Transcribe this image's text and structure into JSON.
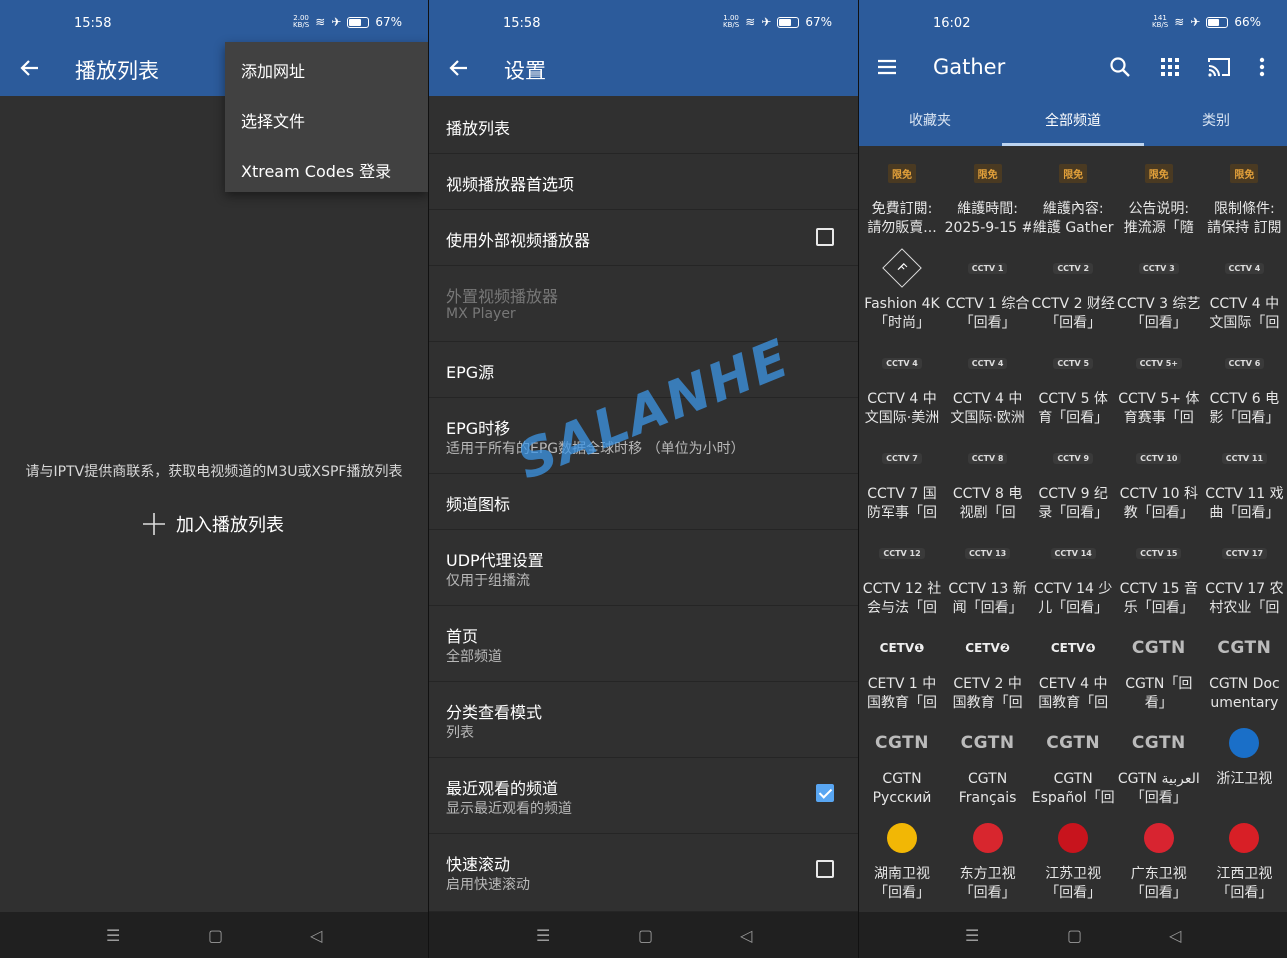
{
  "panels": [
    {
      "status": {
        "time": "15:58",
        "speed_value": "2.00",
        "speed_unit": "KB/S",
        "battery": "67%"
      },
      "title": "播放列表",
      "menu": [
        "添加网址",
        "选择文件",
        "Xtream Codes 登录"
      ],
      "message": "请与IPTV提供商联系，获取电视频道的M3U或XSPF播放列表",
      "add_label": "加入播放列表"
    },
    {
      "status": {
        "time": "15:58",
        "speed_value": "1.00",
        "speed_unit": "KB/S",
        "battery": "67%"
      },
      "title": "设置",
      "settings": [
        {
          "title": "播放列表",
          "subtitle": "",
          "checkbox": null
        },
        {
          "title": "视频播放器首选项",
          "subtitle": "",
          "checkbox": null
        },
        {
          "title": "使用外部视频播放器",
          "subtitle": "",
          "checkbox": false
        },
        {
          "title": "外置视频播放器",
          "subtitle": "MX Player",
          "checkbox": null,
          "disabled": true
        },
        {
          "title": "EPG源",
          "subtitle": "",
          "checkbox": null
        },
        {
          "title": "EPG时移",
          "subtitle": "适用于所有的EPG数据全球时移 （单位为小时）",
          "checkbox": null
        },
        {
          "title": "频道图标",
          "subtitle": "",
          "checkbox": null
        },
        {
          "title": "UDP代理设置",
          "subtitle": "仅用于组播流",
          "checkbox": null
        },
        {
          "title": "首页",
          "subtitle": "全部频道",
          "checkbox": null
        },
        {
          "title": "分类查看模式",
          "subtitle": "列表",
          "checkbox": null
        },
        {
          "title": "最近观看的频道",
          "subtitle": "显示最近观看的频道",
          "checkbox": true
        },
        {
          "title": "快速滚动",
          "subtitle": "启用快速滚动",
          "checkbox": false
        }
      ],
      "watermark": "SALANHE"
    },
    {
      "status": {
        "time": "16:02",
        "speed_value": "141",
        "speed_unit": "KB/S",
        "battery": "66%"
      },
      "title": "Gather",
      "tabs": [
        "收藏夹",
        "全部频道",
        "类别"
      ],
      "active_tab": 1,
      "channels": [
        {
          "line1": "免費訂閱:",
          "line2": "請勿販賣...",
          "logo": "限免",
          "kind": "sc"
        },
        {
          "line1": "維護時間:",
          "line2": "2025-9-15 #",
          "logo": "限免",
          "kind": "sc"
        },
        {
          "line1": "維護內容:",
          "line2": "維護 Gather",
          "logo": "限免",
          "kind": "sc"
        },
        {
          "line1": "公告说明:",
          "line2": "推流源「隨",
          "logo": "限免",
          "kind": "sc"
        },
        {
          "line1": "限制條件:",
          "line2": "請保持 訂閱",
          "logo": "限免",
          "kind": "sc"
        },
        {
          "line1": "Fashion 4K",
          "line2": "「时尚」",
          "logo": "F",
          "kind": "fashion"
        },
        {
          "line1": "CCTV 1 综合",
          "line2": "「回看」",
          "logo": "CCTV 1",
          "kind": "cctv"
        },
        {
          "line1": "CCTV 2 财经",
          "line2": "「回看」",
          "logo": "CCTV 2",
          "kind": "cctv"
        },
        {
          "line1": "CCTV 3 综艺",
          "line2": "「回看」",
          "logo": "CCTV 3",
          "kind": "cctv"
        },
        {
          "line1": "CCTV 4 中",
          "line2": "文国际「回",
          "logo": "CCTV 4",
          "kind": "cctv"
        },
        {
          "line1": "CCTV 4 中",
          "line2": "文国际·美洲",
          "logo": "CCTV 4",
          "kind": "cctv"
        },
        {
          "line1": "CCTV 4 中",
          "line2": "文国际·欧洲",
          "logo": "CCTV 4",
          "kind": "cctv"
        },
        {
          "line1": "CCTV 5 体",
          "line2": "育「回看」",
          "logo": "CCTV 5",
          "kind": "cctv"
        },
        {
          "line1": "CCTV 5+ 体",
          "line2": "育赛事「回",
          "logo": "CCTV 5+",
          "kind": "cctv"
        },
        {
          "line1": "CCTV 6 电",
          "line2": "影「回看」",
          "logo": "CCTV 6",
          "kind": "cctv"
        },
        {
          "line1": "CCTV 7 国",
          "line2": "防军事「回",
          "logo": "CCTV 7",
          "kind": "cctv"
        },
        {
          "line1": "CCTV 8 电",
          "line2": "视剧「回",
          "logo": "CCTV 8",
          "kind": "cctv"
        },
        {
          "line1": "CCTV 9 纪",
          "line2": "录「回看」",
          "logo": "CCTV 9",
          "kind": "cctv"
        },
        {
          "line1": "CCTV 10 科",
          "line2": "教「回看」",
          "logo": "CCTV 10",
          "kind": "cctv"
        },
        {
          "line1": "CCTV 11 戏",
          "line2": "曲「回看」",
          "logo": "CCTV 11",
          "kind": "cctv"
        },
        {
          "line1": "CCTV 12 社",
          "line2": "会与法「回",
          "logo": "CCTV 12",
          "kind": "cctv"
        },
        {
          "line1": "CCTV 13 新",
          "line2": "闻「回看」",
          "logo": "CCTV 13",
          "kind": "cctv"
        },
        {
          "line1": "CCTV 14 少",
          "line2": "儿「回看」",
          "logo": "CCTV 14",
          "kind": "cctv"
        },
        {
          "line1": "CCTV 15 音",
          "line2": "乐「回看」",
          "logo": "CCTV 15",
          "kind": "cctv"
        },
        {
          "line1": "CCTV 17 农",
          "line2": "村农业「回",
          "logo": "CCTV 17",
          "kind": "cctv"
        },
        {
          "line1": "CETV 1 中",
          "line2": "国教育「回",
          "logo": "CETV❶",
          "kind": "cetv"
        },
        {
          "line1": "CETV 2 中",
          "line2": "国教育「回",
          "logo": "CETV❷",
          "kind": "cetv"
        },
        {
          "line1": "CETV 4 中",
          "line2": "国教育「回",
          "logo": "CETV❹",
          "kind": "cetv"
        },
        {
          "line1": "CGTN「回",
          "line2": "看」",
          "logo": "CGTN",
          "kind": "cgtn"
        },
        {
          "line1": "CGTN Doc",
          "line2": "umentary",
          "logo": "CGTN",
          "kind": "cgtn"
        },
        {
          "line1": "CGTN",
          "line2": "Русский",
          "logo": "CGTN",
          "kind": "cgtn"
        },
        {
          "line1": "CGTN",
          "line2": "Français",
          "logo": "CGTN",
          "kind": "cgtn"
        },
        {
          "line1": "CGTN",
          "line2": "Español「回",
          "logo": "CGTN",
          "kind": "cgtn"
        },
        {
          "line1": "CGTN العربية",
          "line2": "「回看」",
          "logo": "CGTN",
          "kind": "cgtn"
        },
        {
          "line1": "浙江卫视",
          "line2": "",
          "logo": "",
          "kind": "zj"
        },
        {
          "line1": "湖南卫视",
          "line2": "「回看」",
          "logo": "",
          "kind": "hn"
        },
        {
          "line1": "东方卫视",
          "line2": "「回看」",
          "logo": "",
          "kind": "df"
        },
        {
          "line1": "江苏卫视",
          "line2": "「回看」",
          "logo": "",
          "kind": "js"
        },
        {
          "line1": "广东卫视",
          "line2": "「回看」",
          "logo": "",
          "kind": "gd"
        },
        {
          "line1": "江西卫视",
          "line2": "「回看」",
          "logo": "",
          "kind": "jx"
        }
      ]
    }
  ],
  "colors": {
    "appbar": "#2c5b9b",
    "background": "#303030",
    "checkbox": "#59a6f2"
  },
  "icons": [
    "back-arrow-icon",
    "wifi-icon",
    "airplane-icon",
    "battery-icon",
    "menu-icon",
    "search-icon",
    "grid-icon",
    "cast-icon",
    "more-vert-icon",
    "plus-icon",
    "nav-recents-icon",
    "nav-home-icon",
    "nav-back-icon"
  ]
}
